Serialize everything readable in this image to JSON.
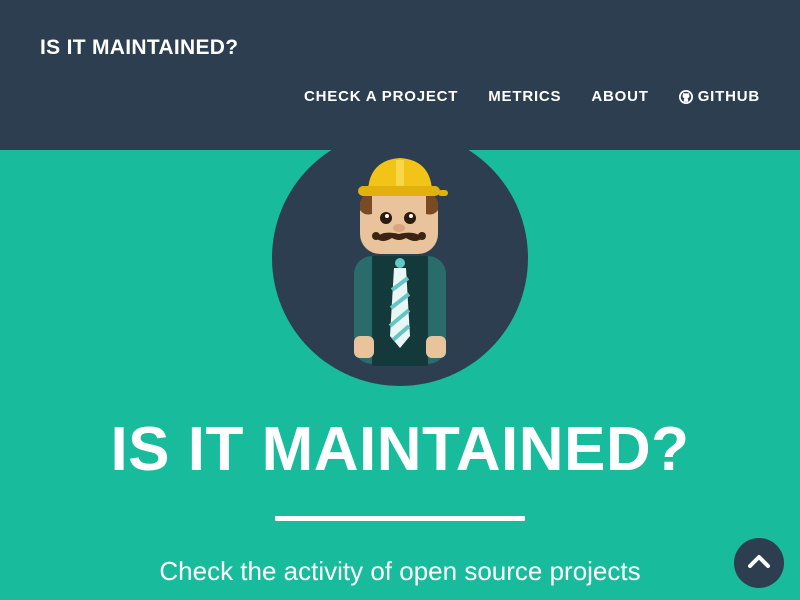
{
  "navbar": {
    "brand": "IS IT MAINTAINED?",
    "links": [
      {
        "label": "CHECK A PROJECT"
      },
      {
        "label": "METRICS"
      },
      {
        "label": "ABOUT"
      },
      {
        "label": "GITHUB",
        "icon": "github-icon"
      }
    ]
  },
  "hero": {
    "avatar": "construction-worker-mascot",
    "title": "IS IT MAINTAINED?",
    "subtitle": "Check the activity of open source projects"
  },
  "scroll_top": {
    "icon": "chevron-up-icon"
  },
  "colors": {
    "navbar": "#2c3e50",
    "accent": "#18bc9c",
    "text": "#ffffff"
  }
}
